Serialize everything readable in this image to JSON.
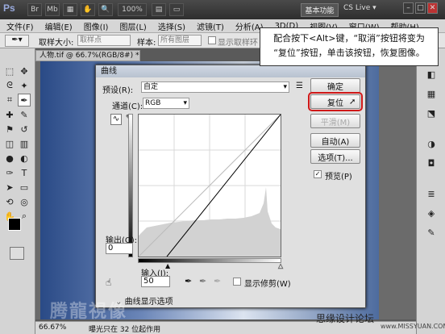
{
  "app": {
    "logo": "Ps",
    "workspace_label": "基本功能",
    "cslive_label": "CS Live",
    "zoom_menu": "100%"
  },
  "menu": [
    "文件(F)",
    "编辑(E)",
    "图像(I)",
    "图层(L)",
    "选择(S)",
    "滤镜(T)",
    "分析(A)",
    "3D(D)",
    "视图(V)",
    "窗口(W)",
    "帮助(H)"
  ],
  "options_bar": {
    "sample_size_label": "取样大小:",
    "sample_size_value": "取样点",
    "sample_label": "样本:",
    "sample_value": "所有图层",
    "show_ring_label": "显示取样环"
  },
  "document": {
    "tab_title": "人物.tif @ 66.7%(RGB/8#) *",
    "zoom": "66.67%",
    "status": "曝光只在 32 位起作用"
  },
  "dialog": {
    "title": "曲线",
    "preset_label": "预设(R):",
    "preset_value": "自定",
    "channel_label": "通道(C):",
    "channel_value": "RGB",
    "output_label": "输出(O):",
    "output_value": "0",
    "input_label": "输入(I):",
    "input_value": "50",
    "show_clipping_label": "显示修剪(W)",
    "curve_options_label": "曲线显示选项",
    "buttons": {
      "ok": "确定",
      "reset": "复位",
      "smooth": "平滑(M)",
      "auto": "自动(A)",
      "options": "选项(T)..."
    },
    "preview_label": "预览(P)"
  },
  "callout": {
    "line1": "配合按下<Alt>键，“取消”按钮将变为",
    "line2": "“复位”按钮，单击该按钮，恢复图像。"
  },
  "watermark": {
    "brand": "腾龍視像",
    "site": "思缘设计论坛",
    "url": "www.MISSYUAN.COM"
  },
  "colors": {
    "accent_red": "#d01818",
    "title_bar": "#3a3a3a"
  }
}
